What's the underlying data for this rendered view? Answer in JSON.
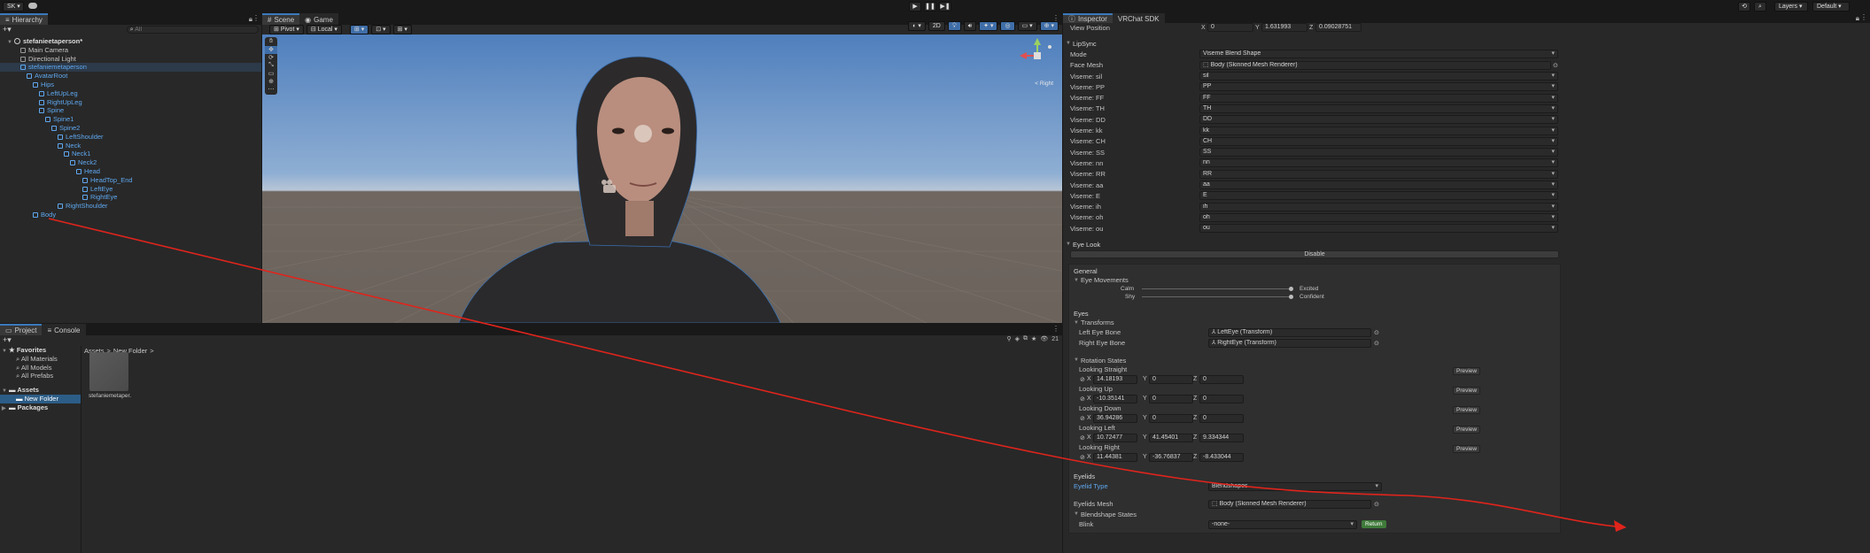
{
  "topbar": {
    "account": "SK",
    "layers": "Layers",
    "layout": "Default"
  },
  "hierarchy": {
    "tab": "Hierarchy",
    "search_placeholder": "All",
    "scene": "stefanieetaperson*",
    "items": [
      {
        "label": "Main Camera",
        "depth": 1,
        "blue": false
      },
      {
        "label": "Directional Light",
        "depth": 1,
        "blue": false
      },
      {
        "label": "stefaniemetaperson",
        "depth": 1,
        "blue": true
      },
      {
        "label": "AvatarRoot",
        "depth": 2,
        "blue": true
      },
      {
        "label": "Hips",
        "depth": 3,
        "blue": true
      },
      {
        "label": "LeftUpLeg",
        "depth": 4,
        "blue": true
      },
      {
        "label": "RightUpLeg",
        "depth": 4,
        "blue": true
      },
      {
        "label": "Spine",
        "depth": 4,
        "blue": true
      },
      {
        "label": "Spine1",
        "depth": 5,
        "blue": true
      },
      {
        "label": "Spine2",
        "depth": 6,
        "blue": true
      },
      {
        "label": "LeftShoulder",
        "depth": 7,
        "blue": true
      },
      {
        "label": "Neck",
        "depth": 7,
        "blue": true
      },
      {
        "label": "Neck1",
        "depth": 8,
        "blue": true
      },
      {
        "label": "Neck2",
        "depth": 9,
        "blue": true
      },
      {
        "label": "Head",
        "depth": 10,
        "blue": true
      },
      {
        "label": "HeadTop_End",
        "depth": 11,
        "blue": true
      },
      {
        "label": "LeftEye",
        "depth": 11,
        "blue": true
      },
      {
        "label": "RightEye",
        "depth": 11,
        "blue": true
      },
      {
        "label": "RightShoulder",
        "depth": 7,
        "blue": true
      },
      {
        "label": "Body",
        "depth": 3,
        "blue": true
      }
    ]
  },
  "scene": {
    "tab_scene": "Scene",
    "tab_game": "Game",
    "pivot": "Pivot",
    "local": "Local",
    "mode_2d": "2D",
    "gizmo_view": "< Right"
  },
  "project": {
    "tab_project": "Project",
    "tab_console": "Console",
    "favorites": "Favorites",
    "fav_items": [
      "All Materials",
      "All Models",
      "All Prefabs"
    ],
    "assets": "Assets",
    "new_folder": "New Folder",
    "packages": "Packages",
    "breadcrumb_root": "Assets",
    "breadcrumb_sep": ">",
    "breadcrumb_folder": "New Folder",
    "breadcrumb_end": ">",
    "asset_name": "stefaniemetaper...",
    "count": "21"
  },
  "inspector": {
    "tab_inspector": "Inspector",
    "tab_sdk": "VRChat SDK",
    "view_position_label": "View Position",
    "view_position": {
      "x": "0",
      "y": "1.631993",
      "z": "0.09028751"
    },
    "lipsync": "LipSync",
    "mode_label": "Mode",
    "mode_value": "Viseme Blend Shape",
    "face_mesh_label": "Face Mesh",
    "face_mesh_value": "Body (Skinned Mesh Renderer)",
    "visemes": [
      {
        "label": "Viseme: sil",
        "value": "sil"
      },
      {
        "label": "Viseme: PP",
        "value": "PP"
      },
      {
        "label": "Viseme: FF",
        "value": "FF"
      },
      {
        "label": "Viseme: TH",
        "value": "TH"
      },
      {
        "label": "Viseme: DD",
        "value": "DD"
      },
      {
        "label": "Viseme: kk",
        "value": "kk"
      },
      {
        "label": "Viseme: CH",
        "value": "CH"
      },
      {
        "label": "Viseme: SS",
        "value": "SS"
      },
      {
        "label": "Viseme: nn",
        "value": "nn"
      },
      {
        "label": "Viseme: RR",
        "value": "RR"
      },
      {
        "label": "Viseme: aa",
        "value": "aa"
      },
      {
        "label": "Viseme: E",
        "value": "E"
      },
      {
        "label": "Viseme: ih",
        "value": "ih"
      },
      {
        "label": "Viseme: oh",
        "value": "oh"
      },
      {
        "label": "Viseme: ou",
        "value": "ou"
      }
    ],
    "eye_look": "Eye Look",
    "disable": "Disable",
    "general": "General",
    "eye_movements": "Eye Movements",
    "calm": "Calm",
    "excited": "Excited",
    "shy": "Shy",
    "confident": "Confident",
    "calm_excited_level": 0.97,
    "shy_confident_level": 0.97,
    "eyes": "Eyes",
    "transforms": "Transforms",
    "left_eye_bone_label": "Left Eye Bone",
    "left_eye_bone": "LeftEye (Transform)",
    "right_eye_bone_label": "Right Eye Bone",
    "right_eye_bone": "RightEye (Transform)",
    "rotation_states": "Rotation States",
    "preview": "Preview",
    "states": [
      {
        "label": "Looking Straight",
        "x": "14.18193",
        "y": "0",
        "z": "0"
      },
      {
        "label": "Looking Up",
        "x": "-10.35141",
        "y": "0",
        "z": "0"
      },
      {
        "label": "Looking Down",
        "x": "36.94286",
        "y": "0",
        "z": "0"
      },
      {
        "label": "Looking Left",
        "x": "10.72477",
        "y": "41.45401",
        "z": "9.334344"
      },
      {
        "label": "Looking Right",
        "x": "11.44381",
        "y": "-36.76837",
        "z": "-8.433044"
      }
    ],
    "eyelids": "Eyelids",
    "eyelid_type_label": "Eyelid Type",
    "eyelid_type": "Blendshapes",
    "eyelids_mesh_label": "Eyelids Mesh",
    "eyelids_mesh": "Body (Skinned Mesh Renderer)",
    "blendshape_states": "Blendshape States",
    "blink_label": "Blink",
    "blink_value": "-none-",
    "return": "Return"
  },
  "colors": {
    "accent": "#3a79bb",
    "hier_blue": "#5fa8f0",
    "annotation_red": "#e0241c",
    "sky_top": "#5b87c2",
    "ground": "#6f6760"
  }
}
